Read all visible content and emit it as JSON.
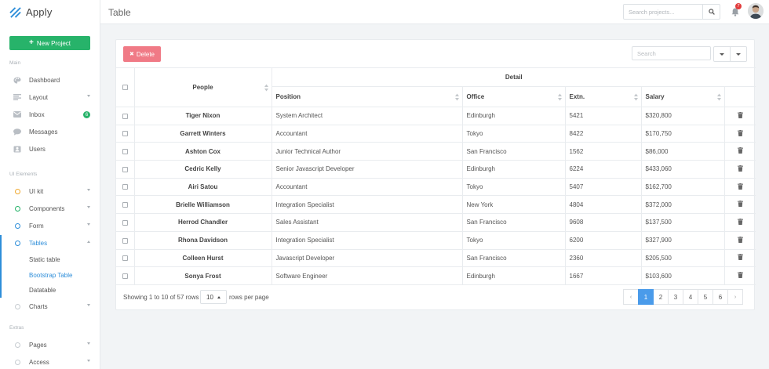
{
  "brand": {
    "name": "Apply"
  },
  "sidebar": {
    "new_project": "New Project",
    "section_main": "Main",
    "section_ui": "UI Elements",
    "section_extra": "Extras",
    "main_items": [
      {
        "label": "Dashboard",
        "icon": "palette-icon"
      },
      {
        "label": "Layout",
        "icon": "layout-icon"
      },
      {
        "label": "Inbox",
        "icon": "mail-icon",
        "badge": "6"
      },
      {
        "label": "Messages",
        "icon": "chat-icon"
      },
      {
        "label": "Users",
        "icon": "contacts-icon"
      }
    ],
    "ui_items": [
      {
        "label": "UI kit",
        "color": "#f0a92f"
      },
      {
        "label": "Components",
        "color": "#27b36a"
      },
      {
        "label": "Form",
        "color": "#2e8ed9"
      },
      {
        "label": "Tables",
        "color": "#2e8ed9"
      }
    ],
    "table_subitems": [
      "Static table",
      "Bootstrap Table",
      "Datatable"
    ],
    "charts": "Charts",
    "extra_items": [
      "Pages",
      "Access"
    ]
  },
  "header": {
    "title": "Table",
    "search_placeholder": "Search projects...",
    "notifications": "7"
  },
  "toolbar": {
    "delete_label": "Delete",
    "search_placeholder": "Search"
  },
  "table": {
    "group_header": "Detail",
    "columns": {
      "people": "People",
      "position": "Position",
      "office": "Office",
      "extn": "Extn.",
      "salary": "Salary"
    },
    "rows": [
      {
        "name": "Tiger Nixon",
        "position": "System Architect",
        "office": "Edinburgh",
        "extn": "5421",
        "salary": "$320,800"
      },
      {
        "name": "Garrett Winters",
        "position": "Accountant",
        "office": "Tokyo",
        "extn": "8422",
        "salary": "$170,750"
      },
      {
        "name": "Ashton Cox",
        "position": "Junior Technical Author",
        "office": "San Francisco",
        "extn": "1562",
        "salary": "$86,000"
      },
      {
        "name": "Cedric Kelly",
        "position": "Senior Javascript Developer",
        "office": "Edinburgh",
        "extn": "6224",
        "salary": "$433,060"
      },
      {
        "name": "Airi Satou",
        "position": "Accountant",
        "office": "Tokyo",
        "extn": "5407",
        "salary": "$162,700"
      },
      {
        "name": "Brielle Williamson",
        "position": "Integration Specialist",
        "office": "New York",
        "extn": "4804",
        "salary": "$372,000"
      },
      {
        "name": "Herrod Chandler",
        "position": "Sales Assistant",
        "office": "San Francisco",
        "extn": "9608",
        "salary": "$137,500"
      },
      {
        "name": "Rhona Davidson",
        "position": "Integration Specialist",
        "office": "Tokyo",
        "extn": "6200",
        "salary": "$327,900"
      },
      {
        "name": "Colleen Hurst",
        "position": "Javascript Developer",
        "office": "San Francisco",
        "extn": "2360",
        "salary": "$205,500"
      },
      {
        "name": "Sonya Frost",
        "position": "Software Engineer",
        "office": "Edinburgh",
        "extn": "1667",
        "salary": "$103,600"
      }
    ]
  },
  "footer": {
    "showing": "Showing 1 to 10 of 57 rows",
    "page_size": "10",
    "rows_per_page": "rows per page",
    "prev": "‹",
    "next": "›",
    "pages": [
      "1",
      "2",
      "3",
      "4",
      "5",
      "6"
    ],
    "current_page": "1"
  }
}
